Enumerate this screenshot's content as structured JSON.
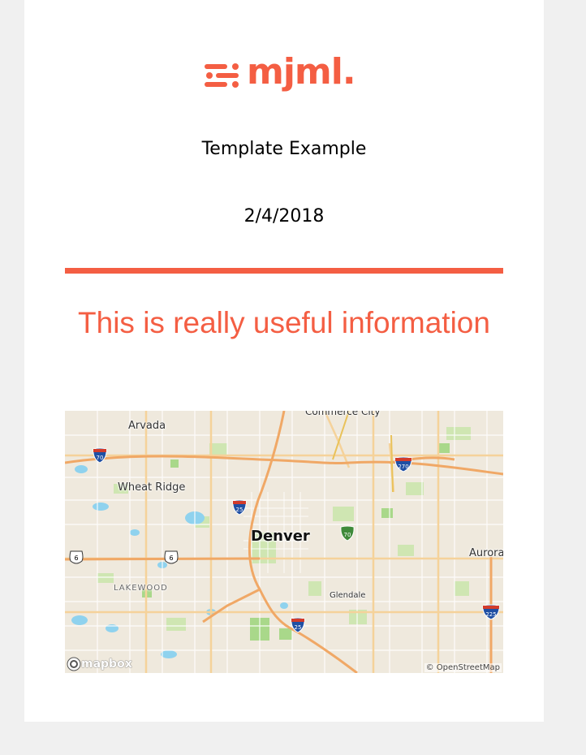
{
  "email": {
    "logo_text": "mjml.",
    "title": "Template Example",
    "date": "2/4/2018",
    "headline": "This is really useful information"
  },
  "colors": {
    "accent": "#f45e43",
    "page_background": "#f0f0f0",
    "card_background": "#ffffff"
  },
  "map": {
    "places": {
      "commerce_city": "Commerce City",
      "arvada": "Arvada",
      "wheat_ridge": "Wheat Ridge",
      "denver": "Denver",
      "aurora": "Aurora",
      "lakewood": "LAKEWOOD",
      "glendale": "Glendale"
    },
    "shields": {
      "i70_west": "70",
      "i270": "270",
      "i25_north": "25",
      "i70_center": "70",
      "us6_west": "6",
      "us6_center": "6",
      "i25_south": "25",
      "i225": "225"
    },
    "attribution": "© OpenStreetMap",
    "brand": "mapbox"
  },
  "icons": [
    "mjml-logo-icon",
    "mapbox-logo-icon",
    "interstate-shield-icon",
    "us-route-shield-icon"
  ]
}
